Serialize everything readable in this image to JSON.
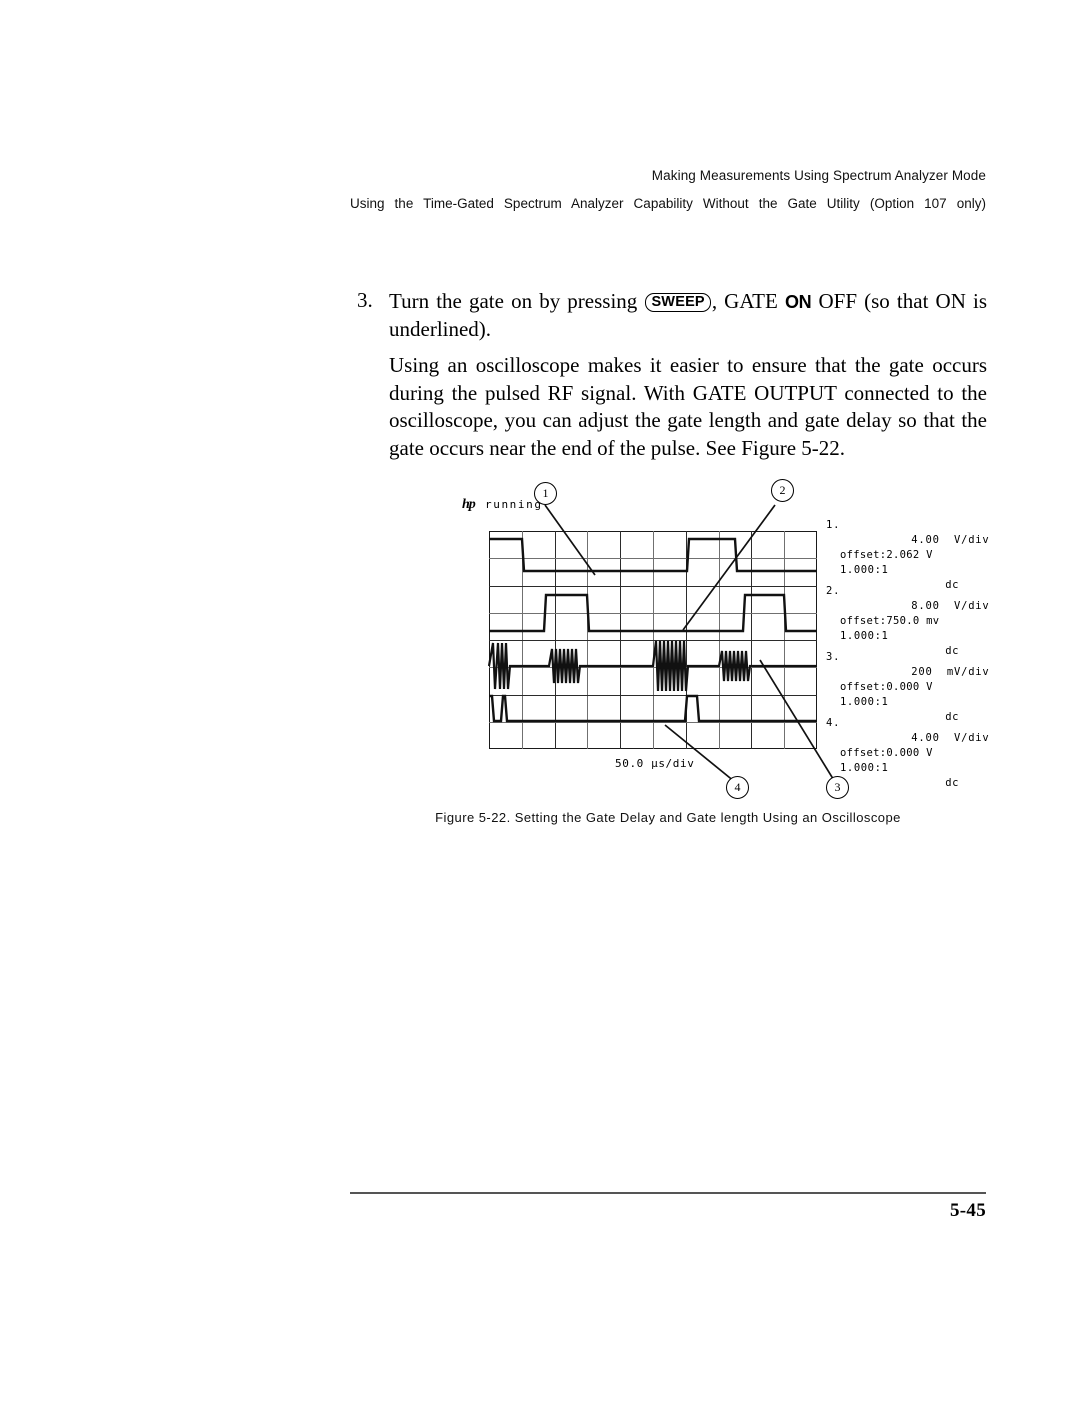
{
  "header": {
    "running_head": "Making Measurements Using Spectrum Analyzer Mode",
    "section_title": "Using the Time-Gated Spectrum Analyzer Capability Without the Gate Utility (Option 107 only)"
  },
  "step": {
    "number": "3.",
    "text_before_key": "Turn the gate on by pressing",
    "key_label": "SWEEP",
    "text_after_key": ", GATE",
    "bold_state": "ON",
    "text_after_state": "OFF (so that ON is",
    "line2": "underlined)."
  },
  "paragraph": {
    "line1": "Using an oscilloscope makes it easier to ensure that the gate occurs",
    "line2": "during the pulsed RF signal. With GATE OUTPUT connected to the",
    "line3": "oscilloscope, you can adjust the gate length and gate delay so that the",
    "line4": "gate occurs near the end of the pulse. See Figure 5-22."
  },
  "figure": {
    "brand_logo": "hp",
    "status": "running",
    "timebase": "50.0 µs/div",
    "callouts": [
      {
        "label": "1"
      },
      {
        "label": "2"
      },
      {
        "label": "3"
      },
      {
        "label": "4"
      }
    ],
    "channels": [
      {
        "number": "1.",
        "scale": "4.00  V/div",
        "offset": "offset:2.062 V",
        "probe": "1.000:1",
        "coupling": "dc"
      },
      {
        "number": "2.",
        "scale": "8.00  V/div",
        "offset": "offset:750.0 mv",
        "probe": "1.000:1",
        "coupling": "dc"
      },
      {
        "number": "3.",
        "scale": "200  mV/div",
        "offset": "offset:0.000 V",
        "probe": "1.000:1",
        "coupling": "dc"
      },
      {
        "number": "4.",
        "scale": "4.00  V/div",
        "offset": "offset:0.000 V",
        "probe": "1.000:1",
        "coupling": "dc"
      }
    ],
    "caption": "Figure 5-22. Setting the Gate Delay and Gate length Using an Oscilloscope"
  },
  "footer": {
    "page_number": "5-45"
  }
}
